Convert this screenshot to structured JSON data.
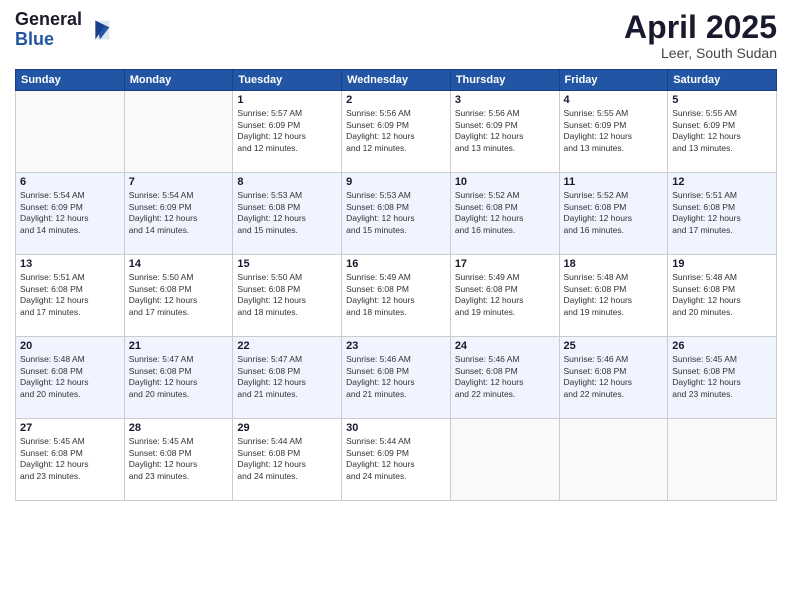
{
  "logo": {
    "general": "General",
    "blue": "Blue"
  },
  "title": "April 2025",
  "location": "Leer, South Sudan",
  "days_of_week": [
    "Sunday",
    "Monday",
    "Tuesday",
    "Wednesday",
    "Thursday",
    "Friday",
    "Saturday"
  ],
  "weeks": [
    [
      {
        "day": "",
        "info": ""
      },
      {
        "day": "",
        "info": ""
      },
      {
        "day": "1",
        "info": "Sunrise: 5:57 AM\nSunset: 6:09 PM\nDaylight: 12 hours\nand 12 minutes."
      },
      {
        "day": "2",
        "info": "Sunrise: 5:56 AM\nSunset: 6:09 PM\nDaylight: 12 hours\nand 12 minutes."
      },
      {
        "day": "3",
        "info": "Sunrise: 5:56 AM\nSunset: 6:09 PM\nDaylight: 12 hours\nand 13 minutes."
      },
      {
        "day": "4",
        "info": "Sunrise: 5:55 AM\nSunset: 6:09 PM\nDaylight: 12 hours\nand 13 minutes."
      },
      {
        "day": "5",
        "info": "Sunrise: 5:55 AM\nSunset: 6:09 PM\nDaylight: 12 hours\nand 13 minutes."
      }
    ],
    [
      {
        "day": "6",
        "info": "Sunrise: 5:54 AM\nSunset: 6:09 PM\nDaylight: 12 hours\nand 14 minutes."
      },
      {
        "day": "7",
        "info": "Sunrise: 5:54 AM\nSunset: 6:09 PM\nDaylight: 12 hours\nand 14 minutes."
      },
      {
        "day": "8",
        "info": "Sunrise: 5:53 AM\nSunset: 6:08 PM\nDaylight: 12 hours\nand 15 minutes."
      },
      {
        "day": "9",
        "info": "Sunrise: 5:53 AM\nSunset: 6:08 PM\nDaylight: 12 hours\nand 15 minutes."
      },
      {
        "day": "10",
        "info": "Sunrise: 5:52 AM\nSunset: 6:08 PM\nDaylight: 12 hours\nand 16 minutes."
      },
      {
        "day": "11",
        "info": "Sunrise: 5:52 AM\nSunset: 6:08 PM\nDaylight: 12 hours\nand 16 minutes."
      },
      {
        "day": "12",
        "info": "Sunrise: 5:51 AM\nSunset: 6:08 PM\nDaylight: 12 hours\nand 17 minutes."
      }
    ],
    [
      {
        "day": "13",
        "info": "Sunrise: 5:51 AM\nSunset: 6:08 PM\nDaylight: 12 hours\nand 17 minutes."
      },
      {
        "day": "14",
        "info": "Sunrise: 5:50 AM\nSunset: 6:08 PM\nDaylight: 12 hours\nand 17 minutes."
      },
      {
        "day": "15",
        "info": "Sunrise: 5:50 AM\nSunset: 6:08 PM\nDaylight: 12 hours\nand 18 minutes."
      },
      {
        "day": "16",
        "info": "Sunrise: 5:49 AM\nSunset: 6:08 PM\nDaylight: 12 hours\nand 18 minutes."
      },
      {
        "day": "17",
        "info": "Sunrise: 5:49 AM\nSunset: 6:08 PM\nDaylight: 12 hours\nand 19 minutes."
      },
      {
        "day": "18",
        "info": "Sunrise: 5:48 AM\nSunset: 6:08 PM\nDaylight: 12 hours\nand 19 minutes."
      },
      {
        "day": "19",
        "info": "Sunrise: 5:48 AM\nSunset: 6:08 PM\nDaylight: 12 hours\nand 20 minutes."
      }
    ],
    [
      {
        "day": "20",
        "info": "Sunrise: 5:48 AM\nSunset: 6:08 PM\nDaylight: 12 hours\nand 20 minutes."
      },
      {
        "day": "21",
        "info": "Sunrise: 5:47 AM\nSunset: 6:08 PM\nDaylight: 12 hours\nand 20 minutes."
      },
      {
        "day": "22",
        "info": "Sunrise: 5:47 AM\nSunset: 6:08 PM\nDaylight: 12 hours\nand 21 minutes."
      },
      {
        "day": "23",
        "info": "Sunrise: 5:46 AM\nSunset: 6:08 PM\nDaylight: 12 hours\nand 21 minutes."
      },
      {
        "day": "24",
        "info": "Sunrise: 5:46 AM\nSunset: 6:08 PM\nDaylight: 12 hours\nand 22 minutes."
      },
      {
        "day": "25",
        "info": "Sunrise: 5:46 AM\nSunset: 6:08 PM\nDaylight: 12 hours\nand 22 minutes."
      },
      {
        "day": "26",
        "info": "Sunrise: 5:45 AM\nSunset: 6:08 PM\nDaylight: 12 hours\nand 23 minutes."
      }
    ],
    [
      {
        "day": "27",
        "info": "Sunrise: 5:45 AM\nSunset: 6:08 PM\nDaylight: 12 hours\nand 23 minutes."
      },
      {
        "day": "28",
        "info": "Sunrise: 5:45 AM\nSunset: 6:08 PM\nDaylight: 12 hours\nand 23 minutes."
      },
      {
        "day": "29",
        "info": "Sunrise: 5:44 AM\nSunset: 6:08 PM\nDaylight: 12 hours\nand 24 minutes."
      },
      {
        "day": "30",
        "info": "Sunrise: 5:44 AM\nSunset: 6:09 PM\nDaylight: 12 hours\nand 24 minutes."
      },
      {
        "day": "",
        "info": ""
      },
      {
        "day": "",
        "info": ""
      },
      {
        "day": "",
        "info": ""
      }
    ]
  ]
}
